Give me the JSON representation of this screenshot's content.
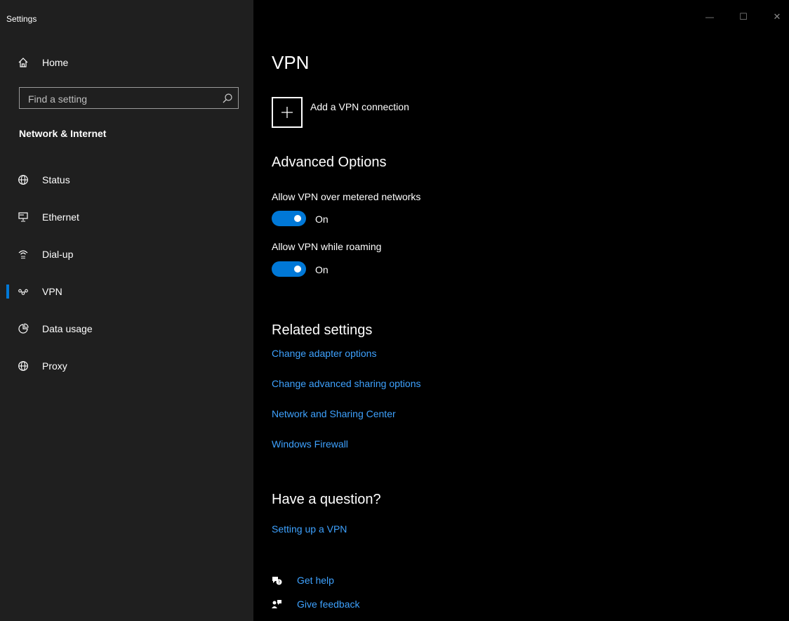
{
  "window": {
    "title": "Settings",
    "minimize_glyph": "—",
    "maximize_glyph": "☐",
    "close_glyph": "✕"
  },
  "sidebar": {
    "home_label": "Home",
    "search_placeholder": "Find a setting",
    "section_title": "Network & Internet",
    "items": [
      {
        "label": "Status",
        "icon": "globe-status-icon"
      },
      {
        "label": "Ethernet",
        "icon": "ethernet-icon"
      },
      {
        "label": "Dial-up",
        "icon": "dialup-icon"
      },
      {
        "label": "VPN",
        "icon": "vpn-icon",
        "active": true
      },
      {
        "label": "Data usage",
        "icon": "data-usage-icon"
      },
      {
        "label": "Proxy",
        "icon": "proxy-globe-icon"
      }
    ]
  },
  "main": {
    "title": "VPN",
    "add_vpn_label": "Add a VPN connection",
    "advanced": {
      "heading": "Advanced Options",
      "metered_label": "Allow VPN over metered networks",
      "metered_state": "On",
      "roaming_label": "Allow VPN while roaming",
      "roaming_state": "On"
    },
    "related": {
      "heading": "Related settings",
      "links": [
        "Change adapter options",
        "Change advanced sharing options",
        "Network and Sharing Center",
        "Windows Firewall"
      ]
    },
    "question": {
      "heading": "Have a question?",
      "link": "Setting up a VPN"
    },
    "help": {
      "get_help": "Get help",
      "give_feedback": "Give feedback"
    }
  },
  "colors": {
    "accent": "#0078d7",
    "link": "#3ea2ff",
    "sidebar_bg": "#1f1f1f",
    "main_bg": "#000000"
  }
}
